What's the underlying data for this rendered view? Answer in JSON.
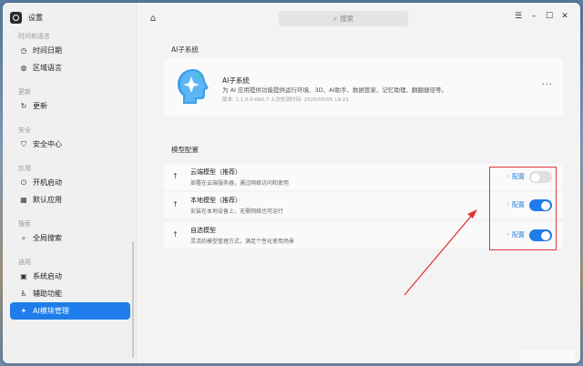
{
  "app": {
    "title": "设置"
  },
  "sidebar": {
    "sections": [
      {
        "title": "时间和语言",
        "items": [
          {
            "label": "时间日期",
            "icon": "clock-icon"
          },
          {
            "label": "区域语言",
            "icon": "globe-icon"
          }
        ]
      },
      {
        "title": "更新",
        "items": [
          {
            "label": "更新",
            "icon": "refresh-icon"
          }
        ]
      },
      {
        "title": "安全",
        "items": [
          {
            "label": "安全中心",
            "icon": "shield-icon"
          }
        ]
      },
      {
        "title": "应用",
        "items": [
          {
            "label": "开机启动",
            "icon": "power-icon"
          },
          {
            "label": "默认应用",
            "icon": "apps-grid-icon"
          }
        ]
      },
      {
        "title": "搜索",
        "items": [
          {
            "label": "全局搜索",
            "icon": "search-icon"
          }
        ]
      },
      {
        "title": "通用",
        "items": [
          {
            "label": "系统启动",
            "icon": "boot-icon"
          },
          {
            "label": "辅助功能",
            "icon": "accessibility-icon"
          },
          {
            "label": "AI模块管理",
            "icon": "ai-icon",
            "active": true
          }
        ]
      }
    ]
  },
  "topbar": {
    "search_placeholder": "搜索"
  },
  "main": {
    "section1_title": "AI子系统",
    "card": {
      "title": "AI子系统",
      "description": "为 AI 应用提供功能提供运行环境、3D、AI助手、数据管家、记忆助理、翻翻捷径等。",
      "meta": "版本: 1.1.0.0-0k0.7  上次检测时间: 2025/05/05 19:21"
    },
    "section2_title": "模型配置",
    "models": [
      {
        "title": "云端模型（推荐）",
        "description": "部署在云端服务器，通过网络访问和使用",
        "config_label": "配置",
        "enabled": false
      },
      {
        "title": "本地模型（推荐）",
        "description": "安装在本地设备上，无需网络也可运行",
        "config_label": "配置",
        "enabled": true
      },
      {
        "title": "自选模型",
        "description": "灵活的模型管理方式，满足个性化使用场景",
        "config_label": "配置",
        "enabled": true
      }
    ]
  },
  "colors": {
    "accent": "#1e7dea",
    "annotation": "#e03838"
  }
}
